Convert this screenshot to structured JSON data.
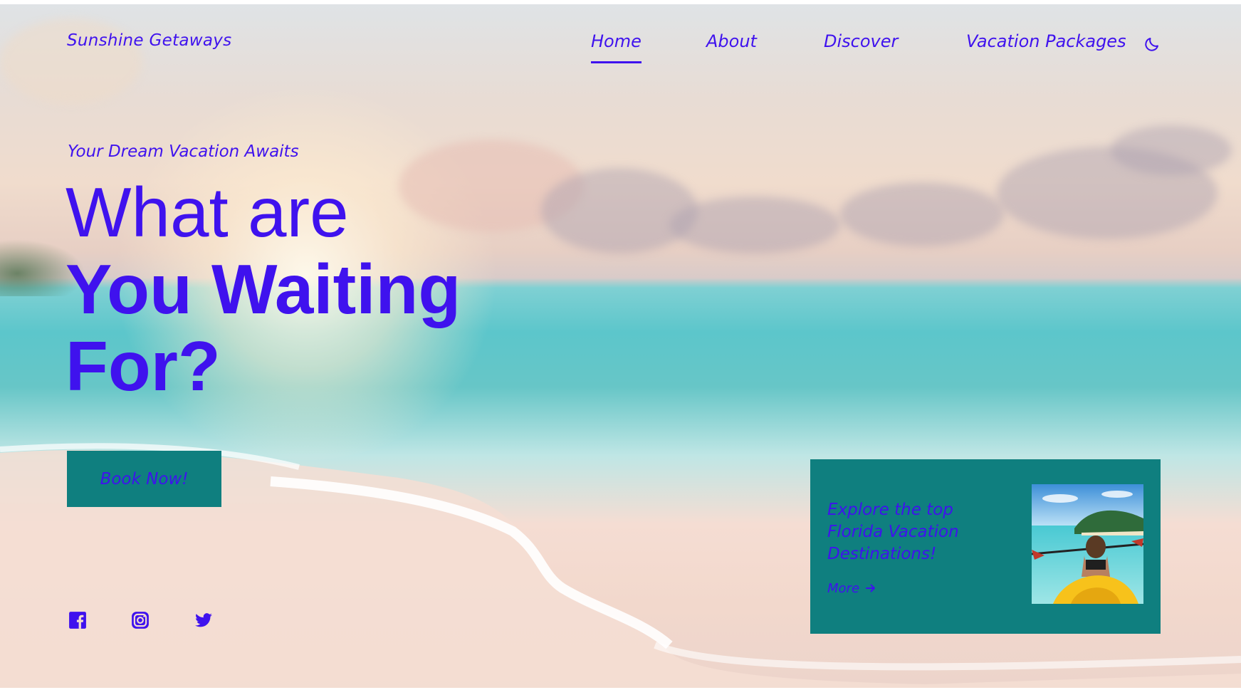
{
  "brand": {
    "name": "Sunshine Getaways"
  },
  "nav": {
    "items": [
      {
        "label": "Home",
        "active": true
      },
      {
        "label": "About",
        "active": false
      },
      {
        "label": "Discover",
        "active": false
      },
      {
        "label": "Vacation Packages",
        "active": false
      }
    ],
    "theme_toggle_icon": "moon-icon"
  },
  "hero": {
    "tagline": "Your Dream Vacation Awaits",
    "headline_line1": "What are",
    "headline_line2": "You Waiting",
    "headline_line3": "For?",
    "cta_label": "Book Now!"
  },
  "social": {
    "icons": [
      "facebook-icon",
      "instagram-icon",
      "twitter-icon"
    ]
  },
  "card": {
    "text": "Explore the top Florida Vacation Destinations!",
    "more_label": "More",
    "more_icon": "arrow-right-icon",
    "image": "kayak-photo"
  },
  "colors": {
    "accent": "#3f12ee",
    "teal": "#0f7f7f"
  }
}
